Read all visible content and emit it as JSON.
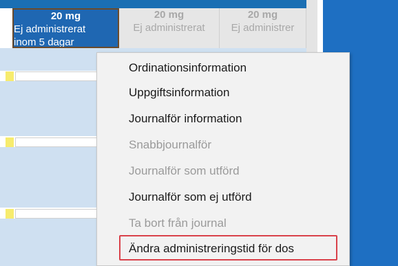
{
  "schedule": {
    "columns": [
      {
        "dose": "20 mg",
        "status_line1": "Ej administrerat",
        "status_line2": "inom 5 dagar"
      },
      {
        "dose": "20 mg",
        "status_line1": "Ej administrerat"
      },
      {
        "dose": "20 mg",
        "status_line1": "Ej administrer"
      }
    ]
  },
  "context_menu": {
    "items": [
      {
        "label": "Ordinationsinformation",
        "enabled": true
      },
      {
        "label": "Uppgiftsinformation",
        "enabled": true
      },
      {
        "label": "Journalför information",
        "enabled": true
      },
      {
        "label": "Snabbjournalför",
        "enabled": false
      },
      {
        "label": "Journalför som utförd",
        "enabled": false
      },
      {
        "label": "Journalför som ej utförd",
        "enabled": true
      },
      {
        "label": "Ta bort från journal",
        "enabled": false
      },
      {
        "label": "Ändra administreringstid för dos",
        "enabled": true,
        "highlighted": true
      }
    ]
  },
  "colors": {
    "accent_blue": "#1f67b2",
    "highlight_red": "#d9414a",
    "marker_yellow": "#f7ec6e"
  }
}
